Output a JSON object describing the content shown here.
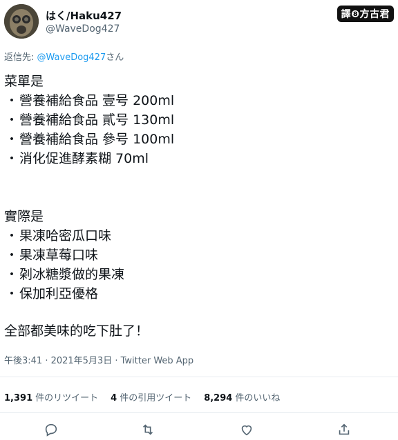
{
  "header": {
    "display_name": "はく/Haku427",
    "handle": "@WaveDog427",
    "badge": "譯❽方古君"
  },
  "reply": {
    "prefix": "返信先: ",
    "mention": "@WaveDog427",
    "suffix": "さん"
  },
  "tweet": {
    "menu_title": "菜單是",
    "menu_items": [
      "營養補給食品 壹号 200ml",
      "營養補給食品 貳号 130ml",
      "營養補給食品 參号 100ml",
      "消化促進酵素糊 70ml"
    ],
    "actual_title": "實際是",
    "actual_items": [
      "果凍哈密瓜口味",
      "果凍草莓口味",
      "刴冰糖漿做的果凍",
      "保加利亞優格"
    ],
    "bullet": "・",
    "closing": "全部都美味的吃下肚了！"
  },
  "meta": {
    "timestamp": "午後3:41 · 2021年5月3日 · Twitter Web App"
  },
  "stats": {
    "retweets_count": "1,391",
    "retweets_label": "件のリツイート",
    "quotes_count": "4",
    "quotes_label": "件の引用ツイート",
    "likes_count": "8,294",
    "likes_label": "件のいいね"
  },
  "actions": [
    "reply-icon",
    "retweet-icon",
    "like-icon",
    "share-icon"
  ]
}
